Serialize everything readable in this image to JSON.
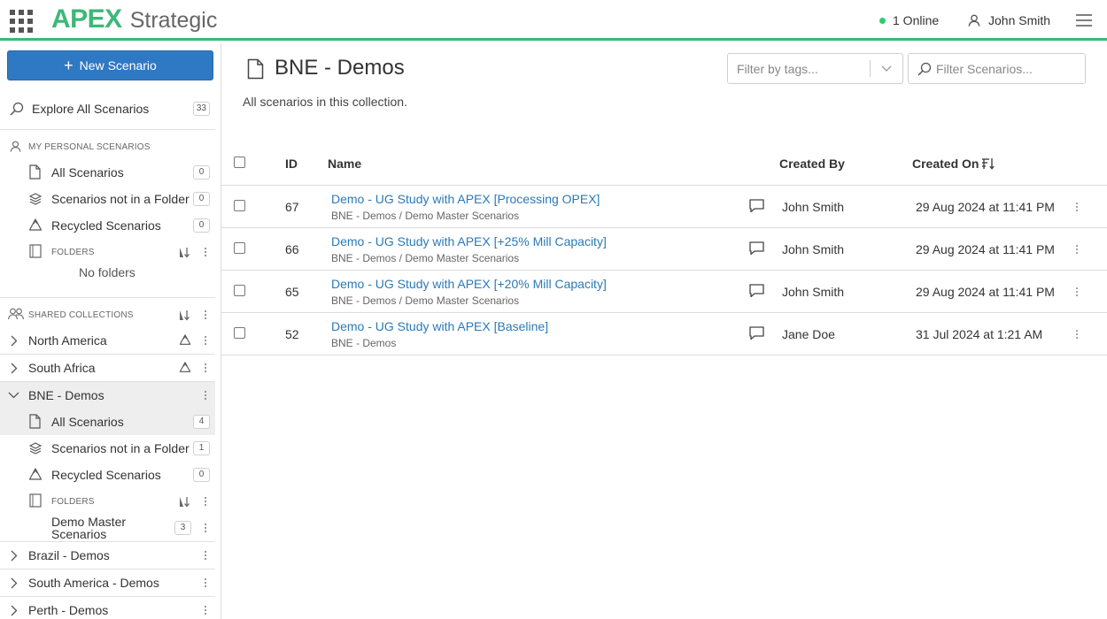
{
  "header": {
    "brand_primary": "APEX",
    "brand_secondary": "Strategic",
    "online_text": "1 Online",
    "user_name": "John Smith",
    "accent_color": "#3cb878"
  },
  "sidebar": {
    "new_button": "New Scenario",
    "explore": {
      "label": "Explore All Scenarios",
      "count": "33"
    },
    "personal": {
      "heading": "MY PERSONAL SCENARIOS",
      "items": [
        {
          "label": "All Scenarios",
          "count": "0"
        },
        {
          "label": "Scenarios not in a Folder",
          "count": "0"
        },
        {
          "label": "Recycled Scenarios",
          "count": "0"
        }
      ],
      "folders_heading": "FOLDERS",
      "no_folders": "No folders"
    },
    "shared": {
      "heading": "SHARED COLLECTIONS",
      "collections": [
        {
          "label": "North America"
        },
        {
          "label": "South Africa"
        },
        {
          "label": "BNE - Demos"
        },
        {
          "label": "Brazil - Demos"
        },
        {
          "label": "South America - Demos"
        },
        {
          "label": "Perth - Demos"
        }
      ],
      "bne_items": [
        {
          "label": "All Scenarios",
          "count": "4"
        },
        {
          "label": "Scenarios not in a Folder",
          "count": "1"
        },
        {
          "label": "Recycled Scenarios",
          "count": "0"
        }
      ],
      "bne_folders_heading": "FOLDERS",
      "bne_folder": {
        "label_line1": "Demo Master",
        "label_line2": "Scenarios",
        "count": "3"
      }
    }
  },
  "main": {
    "title": "BNE - Demos",
    "subtitle": "All scenarios in this collection.",
    "tag_filter_placeholder": "Filter by tags...",
    "search_placeholder": "Filter Scenarios...",
    "columns": {
      "id": "ID",
      "name": "Name",
      "created_by": "Created By",
      "created_on": "Created On"
    },
    "rows": [
      {
        "id": "67",
        "name": "Demo - UG Study with APEX [Processing OPEX]",
        "path": "BNE - Demos / Demo Master Scenarios",
        "created_by": "John Smith",
        "created_on": "29 Aug 2024 at 11:41 PM"
      },
      {
        "id": "66",
        "name": "Demo - UG Study with APEX [+25% Mill Capacity]",
        "path": "BNE - Demos / Demo Master Scenarios",
        "created_by": "John Smith",
        "created_on": "29 Aug 2024 at 11:41 PM"
      },
      {
        "id": "65",
        "name": "Demo - UG Study with APEX [+20% Mill Capacity]",
        "path": "BNE - Demos / Demo Master Scenarios",
        "created_by": "John Smith",
        "created_on": "29 Aug 2024 at 11:41 PM"
      },
      {
        "id": "52",
        "name": "Demo - UG Study with APEX [Baseline]",
        "path": "BNE - Demos",
        "created_by": "Jane Doe",
        "created_on": "31 Jul 2024 at 1:21 AM"
      }
    ]
  }
}
